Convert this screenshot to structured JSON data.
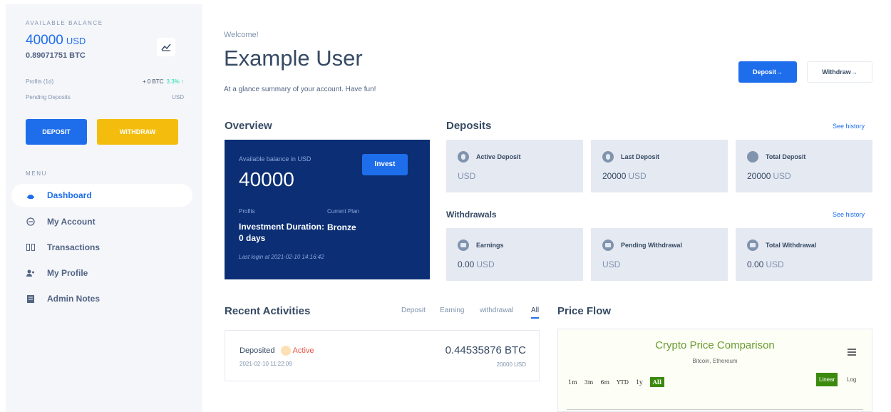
{
  "sidebar": {
    "available_balance_label": "AVAILABLE BALANCE",
    "balance_amount": "40000",
    "balance_currency": "USD",
    "balance_btc": "0.89071751 BTC",
    "profits_label": "Profits (1d)",
    "profits_value": "+ 0 BTC",
    "profits_change": "3.3%",
    "pending_label": "Pending Deposits",
    "pending_value": "USD",
    "deposit_button": "DEPOSIT",
    "withdraw_button": "WITHDRAW",
    "menu_label": "MENU",
    "menu_items": [
      {
        "label": "Dashboard",
        "icon": "dashboard-icon"
      },
      {
        "label": "My Account",
        "icon": "account-icon"
      },
      {
        "label": "Transactions",
        "icon": "transactions-icon"
      },
      {
        "label": "My Profile",
        "icon": "profile-icon"
      },
      {
        "label": "Admin Notes",
        "icon": "notes-icon"
      }
    ]
  },
  "header": {
    "welcome": "Welcome!",
    "username": "Example User",
    "subtitle": "At a glance summary of your account. Have fun!",
    "deposit_button": "Deposit→",
    "withdraw_button": "Withdraw→"
  },
  "overview": {
    "title": "Overview",
    "available_label": "Available balance in USD",
    "amount": "40000",
    "invest_button": "Invest",
    "profits_label": "Profits",
    "profits_value": "Investment Duration: 0 days",
    "plan_label": "Current Plan",
    "plan_value": "Bronze",
    "last_login": "Last login at 2021-02-10 14:16:42"
  },
  "deposits": {
    "title": "Deposits",
    "see_history": "See history",
    "cards": [
      {
        "label": "Active Deposit",
        "value": "",
        "unit": "USD"
      },
      {
        "label": "Last Deposit",
        "value": "20000",
        "unit": "USD"
      },
      {
        "label": "Total Deposit",
        "value": "20000",
        "unit": "USD"
      }
    ]
  },
  "withdrawals": {
    "title": "Withdrawals",
    "see_history": "See history",
    "cards": [
      {
        "label": "Earnings",
        "value": "0.00",
        "unit": "USD"
      },
      {
        "label": "Pending Withdrawal",
        "value": "",
        "unit": "USD"
      },
      {
        "label": "Total Withdrawal",
        "value": "0.00",
        "unit": "USD"
      }
    ]
  },
  "activities": {
    "title": "Recent Activities",
    "tabs": [
      "Deposit",
      "Earning",
      "withdrawal",
      "All"
    ],
    "active_tab": "All",
    "items": [
      {
        "type": "Deposited",
        "status": "Active",
        "date": "2021-02-10 11:22:09",
        "amount": "0.44535876 BTC",
        "usd": "20000 USD"
      }
    ]
  },
  "price_flow": {
    "title": "Price Flow",
    "chart_title": "Crypto Price Comparison",
    "chart_subtitle": "Bitcoin, Ethereum",
    "ranges": [
      "1m",
      "3m",
      "6m",
      "YTD",
      "1y",
      "All"
    ],
    "selected_range": "All",
    "scale_linear": "Linear",
    "scale_log": "Log"
  },
  "colors": {
    "primary": "#1e6eeb",
    "warning": "#f4bd0e",
    "overview_bg": "#0b2e74",
    "card_bg": "#e5e9f2",
    "chart_green": "#3b8a0e"
  }
}
